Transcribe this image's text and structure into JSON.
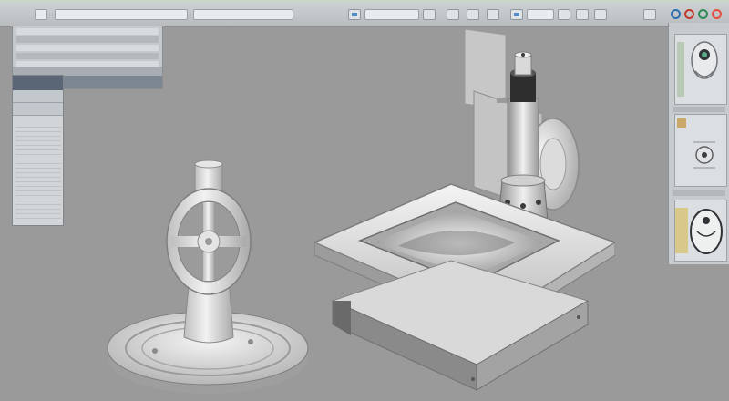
{
  "toolbar": {
    "icons": [
      "field",
      "field",
      "field",
      "doc-icon",
      "field",
      "doc-icon",
      "field",
      "doc-icon",
      "nav-circles"
    ],
    "circle_colors": [
      "#2b6fb0",
      "#c0392b",
      "#2e8b57",
      "#e74c3c"
    ]
  },
  "left_panel": {
    "rows": [
      "",
      "",
      "",
      "",
      ""
    ]
  },
  "properties_panel": {
    "header": ""
  },
  "right_panel": {
    "thumbnails": [
      "part-front-view",
      "part-top-view",
      "part-oval-view"
    ]
  },
  "viewport": {
    "objects": [
      "cast-part-with-wheel-base",
      "cnc-milling-machine"
    ]
  }
}
